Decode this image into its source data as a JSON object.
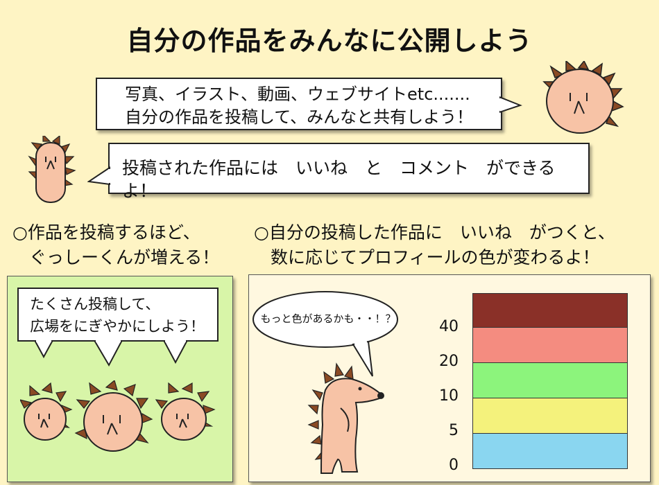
{
  "title": "自分の作品をみんなに公開しよう",
  "intro": {
    "line1": "写真、イラスト、動画、ウェブサイトetc.......",
    "line2": "自分の作品を投稿して、みんなと共有しよう！"
  },
  "like_comment": "投稿された作品には　いいね　と　コメント　ができるよ！",
  "notice_left": {
    "line1": "○作品を投稿するほど、",
    "line2": "ぐっしーくんが増える！"
  },
  "notice_right": {
    "line1": "○自分の投稿した作品に　いいね　がつくと、",
    "line2": "数に応じてプロフィールの色が変わるよ！"
  },
  "left_panel": {
    "bubble_line1": "たくさん投稿して、",
    "bubble_line2": "広場をにぎやかにしよう！",
    "bg_color": "#d8f5a8"
  },
  "right_panel": {
    "thought": "もっと色があるかも・・！？",
    "bg_color": "#fff8e0"
  },
  "color_scale": {
    "ticks": [
      "0",
      "5",
      "10",
      "20",
      "40"
    ],
    "bands": [
      {
        "from": "0",
        "to": "5",
        "color": "#8ad6f0"
      },
      {
        "from": "5",
        "to": "10",
        "color": "#f4f27c"
      },
      {
        "from": "10",
        "to": "20",
        "color": "#8cf47c"
      },
      {
        "from": "20",
        "to": "40",
        "color": "#f48c80"
      },
      {
        "from": "40",
        "to": "",
        "color": "#8a3028"
      }
    ]
  },
  "icons": {
    "mascot": "hedgehog-mascot-icon"
  }
}
